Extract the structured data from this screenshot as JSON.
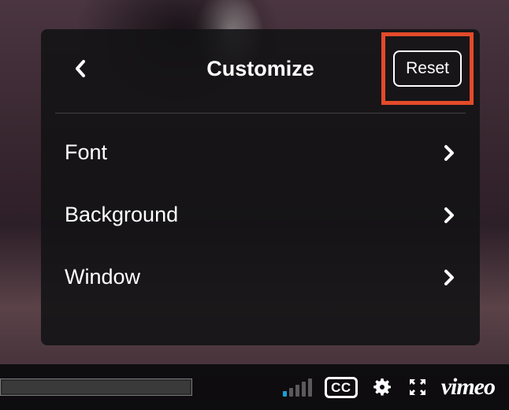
{
  "panel": {
    "title": "Customize",
    "reset_label": "Reset",
    "items": [
      {
        "label": "Font"
      },
      {
        "label": "Background"
      },
      {
        "label": "Window"
      }
    ]
  },
  "controls": {
    "cc_label": "CC",
    "vimeo_label": "vimeo"
  },
  "highlight": {
    "color": "#e34a2a"
  }
}
